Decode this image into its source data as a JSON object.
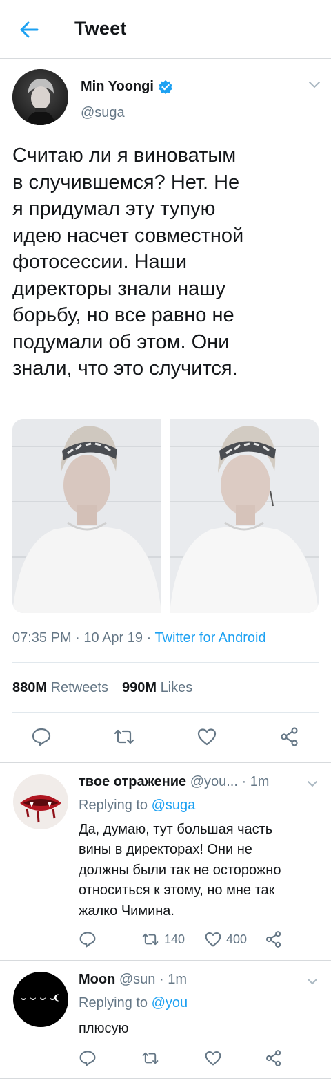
{
  "header": {
    "title": "Tweet"
  },
  "tweet": {
    "author_name": "Min Yoongi",
    "author_handle": "@suga",
    "text": "Считаю ли я виноватым\nв случившемся? Нет. Не\nя придумал эту тупую\nидею насчет совместной\nфотосессии. Наши\nдиректоры знали нашу\nборьбу, но все равно не\nподумали об этом. Они\nзнали, что это случится.",
    "time": "07:35 PM",
    "date": "10 Apr 19",
    "client": "Twitter for Android",
    "retweets": "880M",
    "retweets_label": "Retweets",
    "likes": "990M",
    "likes_label": "Likes"
  },
  "replies": [
    {
      "name": "твое отражение",
      "handle": "@you...",
      "time": "1m",
      "replying_label": "Replying to",
      "replying_to": "@suga",
      "text": "Да, думаю, тут большая часть\nвины в директорах! Они не\nдолжны были так не осторожно\nотноситься к этому, но мне так\nжалко Чимина.",
      "retweets": "140",
      "likes": "400"
    },
    {
      "name": "Moon",
      "handle": "@sun",
      "time": "1m",
      "replying_label": "Replying to",
      "replying_to": "@you",
      "text": "плюсую",
      "retweets": "",
      "likes": ""
    }
  ],
  "colors": {
    "accent": "#1da1f2",
    "secondary_text": "#657786",
    "primary_text": "#14171a",
    "divider": "#e1e8ed"
  },
  "icons": [
    "back-arrow-icon",
    "verified-badge-icon",
    "chevron-down-icon",
    "reply-icon",
    "retweet-icon",
    "like-icon",
    "share-icon"
  ]
}
